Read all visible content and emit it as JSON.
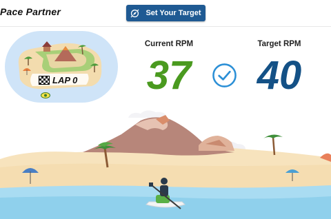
{
  "app": {
    "title": "Pace Partner"
  },
  "toolbar": {
    "set_target_label": "Set Your Target"
  },
  "map": {
    "lap_label": "LAP 0"
  },
  "stats": {
    "current_label": "Current RPM",
    "current_value": "37",
    "target_label": "Target RPM",
    "target_value": "40"
  },
  "colors": {
    "brand": "#1f5a93",
    "current_value": "#4a9a1f",
    "target_value": "#145186",
    "check": "#2b8fd6"
  },
  "icons": {
    "target_button": "compass-icon",
    "status": "checkmark-circle-icon",
    "lap": "checkered-flag-icon"
  }
}
